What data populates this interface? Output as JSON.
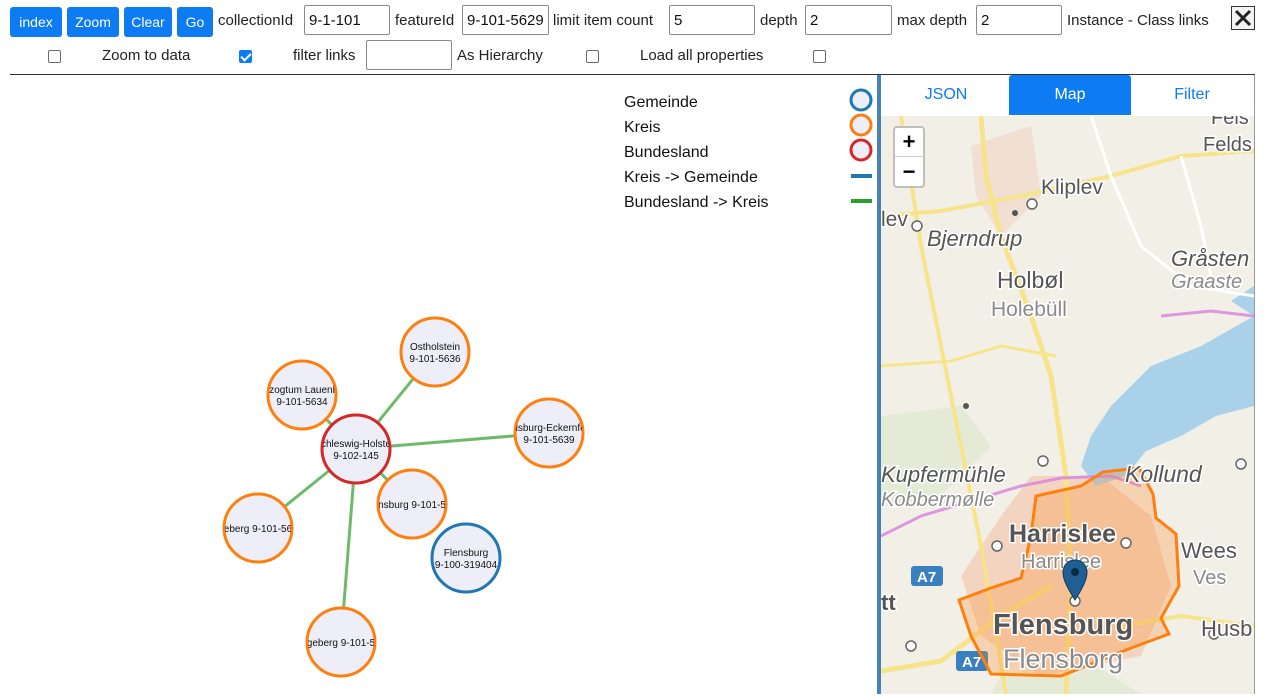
{
  "toolbar": {
    "index_label": "index",
    "zoom_label": "Zoom",
    "clear_label": "Clear",
    "go_label": "Go",
    "collection_label": "collectionId",
    "collection_value": "9-1-101",
    "feature_label": "featureId",
    "feature_value": "9-101-5629",
    "limit_label": "limit item count",
    "limit_value": "5",
    "depth_label": "depth",
    "depth_value": "2",
    "maxdepth_label": "max depth",
    "maxdepth_value": "2",
    "instance_label": "Instance - Class links"
  },
  "options": {
    "zoom_to_data_label": "Zoom to data",
    "zoom_to_data_checked": true,
    "filter_links_label": "filter links",
    "filter_links_value": "",
    "as_hierarchy_label": "As Hierarchy",
    "as_hierarchy_checked": false,
    "load_all_label": "Load all properties",
    "load_all_checked": false
  },
  "legend": [
    {
      "label": "Gemeinde",
      "shape": "circle",
      "color": "#1f77b4"
    },
    {
      "label": "Kreis",
      "shape": "circle",
      "color": "#ff7f0e"
    },
    {
      "label": "Bundesland",
      "shape": "circle",
      "color": "#d62728"
    },
    {
      "label": "Kreis -> Gemeinde",
      "shape": "line",
      "color": "#1f77b4"
    },
    {
      "label": "Bundesland -> Kreis",
      "shape": "line",
      "color": "#2ca02c"
    }
  ],
  "graph": {
    "node_fill": "#eeeef8",
    "link_color": "#6dbb6a",
    "nodes": [
      {
        "id": "n_osth",
        "type": "Kreis",
        "line1": "Ostholstein",
        "line2": "9-101-5636"
      },
      {
        "id": "n_lau",
        "type": "Kreis",
        "line1": "zogtum Lauenl",
        "line2": "9-101-5634"
      },
      {
        "id": "n_sh",
        "type": "Bundesland",
        "line1": "chleswig-Holste",
        "line2": "9-102-145"
      },
      {
        "id": "n_rde",
        "type": "Kreis",
        "line1": "dsburg-Eckernfö",
        "line2": "9-101-5639"
      },
      {
        "id": "n_fl",
        "type": "Kreis",
        "line1": "nsburg 9-101-5",
        "line2": ""
      },
      {
        "id": "n_seg",
        "type": "Kreis",
        "line1": "eberg 9-101-56",
        "line2": ""
      },
      {
        "id": "n_flg",
        "type": "Gemeinde",
        "line1": "Flensburg",
        "line2": "9-100-319404"
      },
      {
        "id": "n_ber",
        "type": "Kreis",
        "line1": "geberg 9-101-5",
        "line2": ""
      }
    ]
  },
  "tabs": [
    {
      "label": "JSON",
      "active": false
    },
    {
      "label": "Map",
      "active": true
    },
    {
      "label": "Filter",
      "active": false
    }
  ],
  "map": {
    "zoom_in": "+",
    "zoom_out": "−",
    "labels": {
      "felds": "Felds",
      "feis": "Feis",
      "kliplev": "Kliplev",
      "lev": "lev",
      "bjerndrup": "Bjerndrup",
      "holbol": "Holbøl",
      "holebull": "Holebüll",
      "grasten": "Gråsten",
      "graaste": "Graaste",
      "kupfermuhle": "Kupfermühle",
      "kobbermolle": "Kobbermølle",
      "kollund": "Kollund",
      "harrislee": "Harrislee",
      "harrislee2": "Harrislee",
      "wees": "Wees",
      "ves": "Ves",
      "a7": "A7",
      "a7b": "A7",
      "tt": "tt",
      "flensburg": "Flensburg",
      "flensborg": "Flensborg",
      "husb": "Husb"
    }
  }
}
